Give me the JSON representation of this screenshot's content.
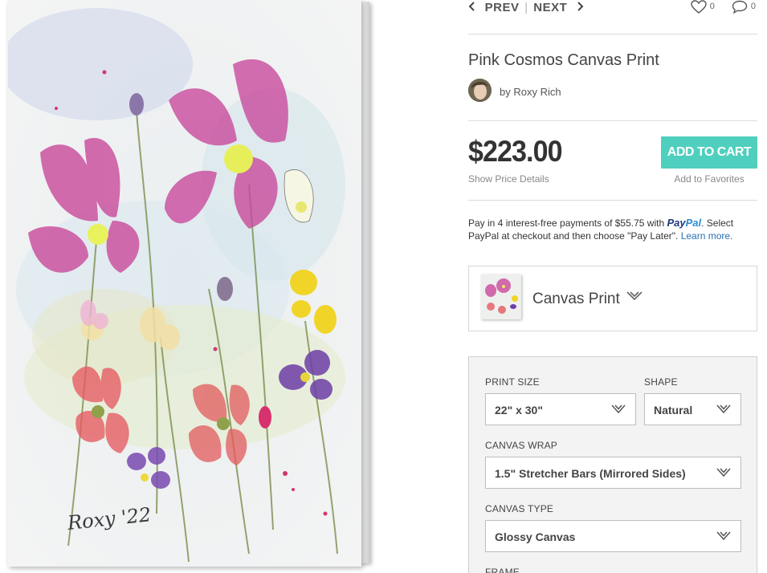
{
  "nav": {
    "prev_label": "PREV",
    "next_label": "NEXT",
    "prev_icon": "chevron-left-icon",
    "next_icon": "chevron-right-icon"
  },
  "social": {
    "likes_count": "0",
    "comments_count": "0",
    "like_icon": "heart-icon",
    "comment_icon": "comment-bubble-icon"
  },
  "product": {
    "title": "Pink Cosmos Canvas Print",
    "artist": "by Roxy Rich"
  },
  "pricing": {
    "price": "$223.00",
    "show_details": "Show Price Details",
    "add_to_cart": "ADD TO CART",
    "add_to_favorites": "Add to Favorites",
    "accent_color": "#4fcfbe"
  },
  "paypal": {
    "text_before": "Pay in 4 interest-free payments of $55.75 with ",
    "logo_part1": "Pay",
    "logo_part2": "Pal",
    "text_after": ". Select PayPal at checkout and then choose \"Pay Later\". ",
    "learn_more": "Learn more."
  },
  "product_type": {
    "label": "Canvas Print"
  },
  "options": {
    "print_size": {
      "label": "PRINT SIZE",
      "value": "22\" x 30\""
    },
    "shape": {
      "label": "SHAPE",
      "value": "Natural"
    },
    "canvas_wrap": {
      "label": "CANVAS WRAP",
      "value": "1.5\" Stretcher Bars (Mirrored Sides)"
    },
    "canvas_type": {
      "label": "CANVAS TYPE",
      "value": "Glossy Canvas"
    },
    "frame": {
      "label": "FRAME"
    }
  },
  "artwork": {
    "signature": "Roxy '22"
  }
}
